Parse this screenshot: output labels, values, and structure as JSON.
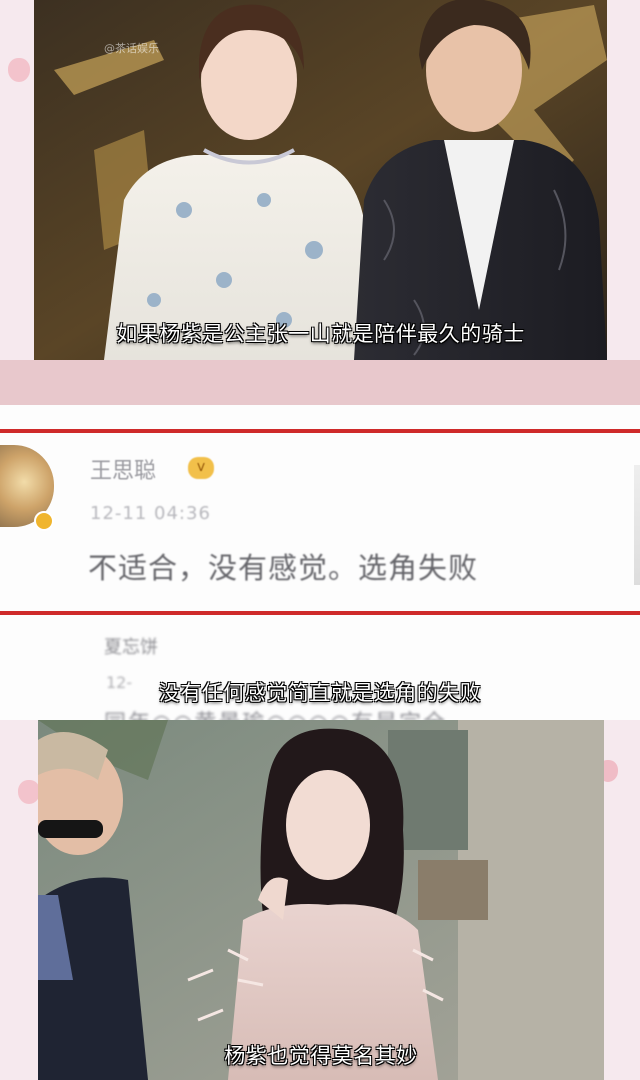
{
  "top_video": {
    "watermark": "@茶话娱乐",
    "subtitle": "如果杨紫是公主张一山就是陪伴最久的骑士"
  },
  "comment_screenshot": {
    "comment1": {
      "username": "王思聪",
      "vip_badge": "V",
      "time": "12-11 04:36",
      "text": "不适合，没有感觉。选角失败"
    },
    "comment2": {
      "username": "夏忘饼",
      "time": "12-",
      "text": "同年○○黄景瑜○○○○有是完全"
    },
    "subtitle": "没有任何感觉简直就是选角的失败"
  },
  "bottom_video": {
    "subtitle": "杨紫也觉得莫名其妙"
  },
  "colors": {
    "page_background": "#f6e9ee",
    "pink_band": "#e8c8cc",
    "weibo_red_line": "#cf2a2a",
    "subtitle_text": "#ffffff"
  }
}
